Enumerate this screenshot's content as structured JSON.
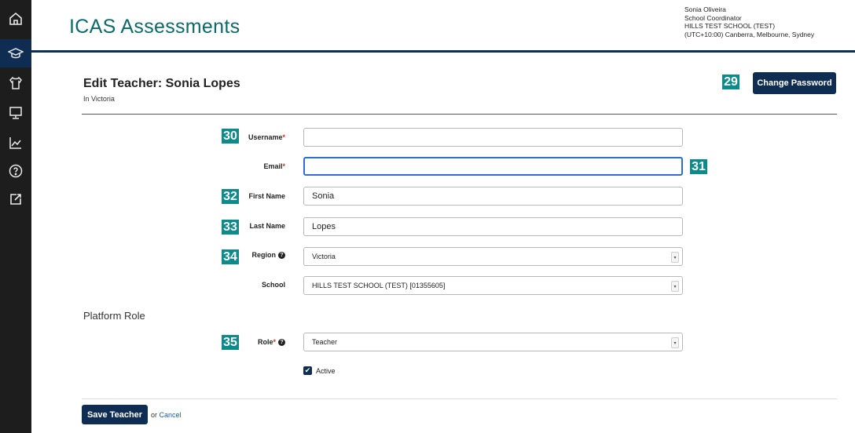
{
  "app": {
    "title": "ICAS Assessments"
  },
  "user": {
    "name": "Sonia Oliveira",
    "role": "School Coordinator",
    "school": "HILLS TEST SCHOOL (TEST)",
    "timezone": "(UTC+10:00) Canberra, Melbourne, Sydney"
  },
  "sidebar": {
    "items": [
      {
        "icon": "home-icon",
        "active": false
      },
      {
        "icon": "graduation-cap-icon",
        "active": true
      },
      {
        "icon": "shirt-icon",
        "active": false
      },
      {
        "icon": "monitor-icon",
        "active": false
      },
      {
        "icon": "chart-icon",
        "active": false
      },
      {
        "icon": "help-circle-icon",
        "active": false
      },
      {
        "icon": "external-edit-icon",
        "active": false
      }
    ]
  },
  "page": {
    "title": "Edit Teacher: Sonia Lopes",
    "subtitle": "In Victoria",
    "change_password": "Change Password"
  },
  "badges": {
    "b29": "29",
    "b30": "30",
    "b31": "31",
    "b32": "32",
    "b33": "33",
    "b34": "34",
    "b35": "35"
  },
  "form": {
    "username": {
      "label": "Username",
      "required": "*",
      "value": ""
    },
    "email": {
      "label": "Email",
      "required": "*",
      "value": ""
    },
    "first_name": {
      "label": "First Name",
      "value": "Sonia"
    },
    "last_name": {
      "label": "Last Name",
      "value": "Lopes"
    },
    "region": {
      "label": "Region",
      "value": "Victoria",
      "help": "?"
    },
    "school": {
      "label": "School",
      "value": "HILLS TEST SCHOOL (TEST) [01355605]"
    },
    "platform_role_title": "Platform Role",
    "role": {
      "label": "Role",
      "required": "*",
      "value": "Teacher",
      "help": "?"
    },
    "active": {
      "label": "Active",
      "checked": true
    }
  },
  "actions": {
    "save": "Save Teacher",
    "or": "or",
    "cancel": "Cancel"
  },
  "colors": {
    "navy": "#0f2d52",
    "teal": "#0b6b6b",
    "badge": "#0d8a8a",
    "sidebar": "#1d1d1d"
  }
}
